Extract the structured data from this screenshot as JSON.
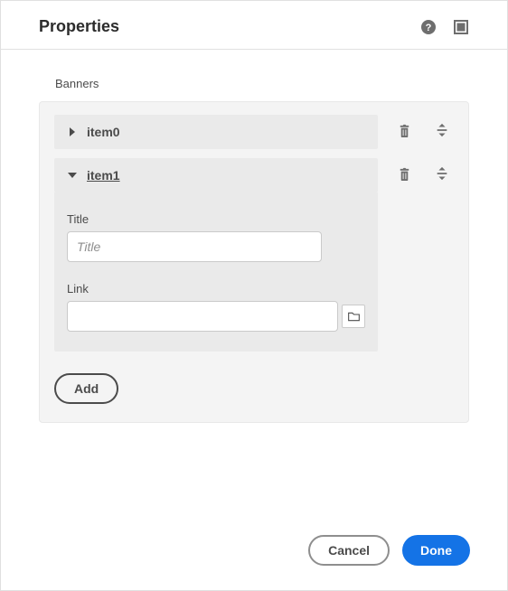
{
  "header": {
    "title": "Properties"
  },
  "section": {
    "label": "Banners"
  },
  "items": [
    {
      "label": "item0",
      "expanded": false
    },
    {
      "label": "item1",
      "expanded": true
    }
  ],
  "fields": {
    "title_label": "Title",
    "title_placeholder": "Title",
    "title_value": "",
    "link_label": "Link",
    "link_value": ""
  },
  "buttons": {
    "add": "Add",
    "cancel": "Cancel",
    "done": "Done"
  }
}
